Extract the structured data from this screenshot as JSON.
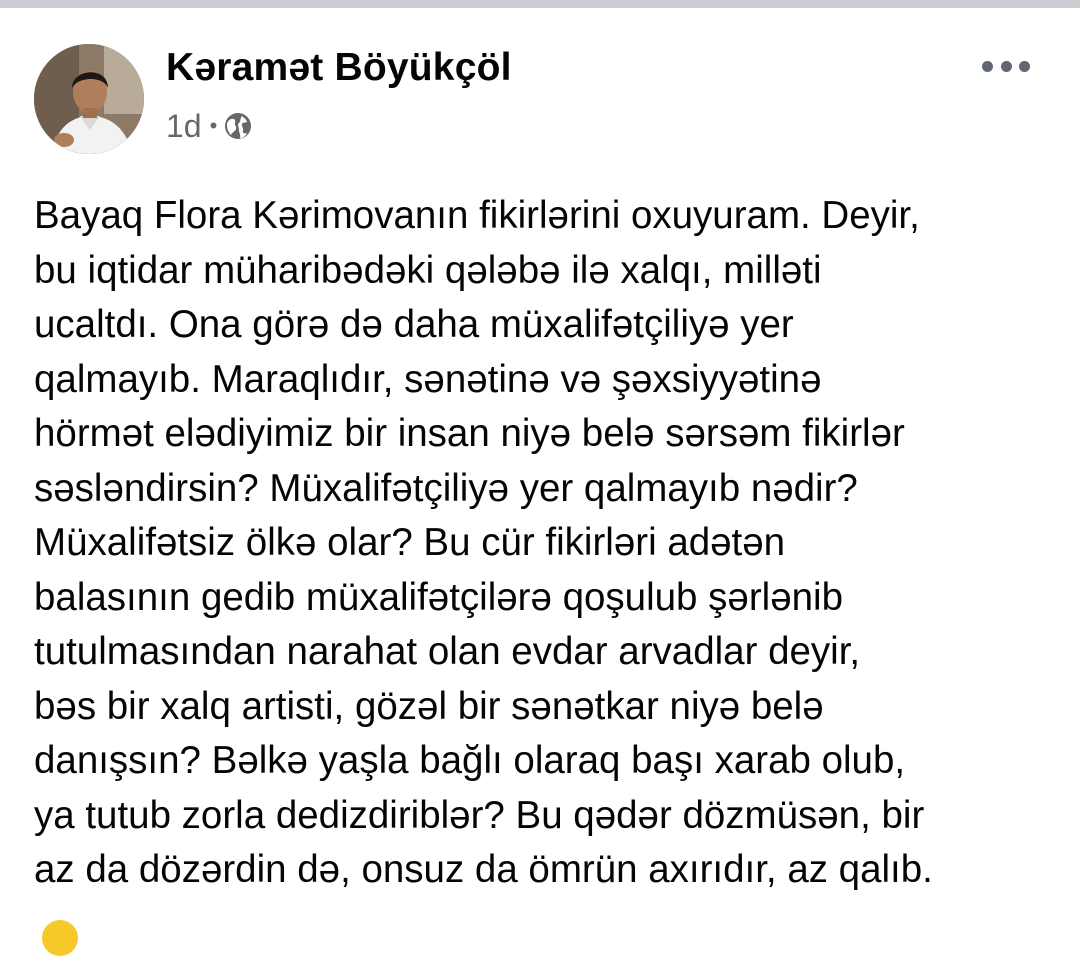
{
  "post": {
    "author_name": "Kəramət Böyükçöl",
    "timestamp": "1d",
    "separator": "•",
    "privacy_icon": "globe-icon",
    "more_icon": "more-horizontal-icon",
    "text": "Bayaq Flora Kərimovanın fikirlərini oxuyuram. Deyir,\nbu iqtidar müharibədəki qələbə ilə xalqı, milləti\nucaltdı. Ona görə də daha müxalifətçiliyə yer\nqalmayıb. Maraqlıdır, sənətinə və şəxsiyyətinə\nhörmət elədiyimiz bir insan niyə belə sərsəm fikirlər\nsəsləndirsin? Müxalifətçiliyə yer qalmayıb nədir?\nMüxalifətsiz ölkə olar? Bu cür fikirləri adətən\nbalasının gedib müxalifətçilərə qoşulub şərlənib\ntutulmasından narahat olan evdar arvadlar deyir,\nbəs bir xalq artisti, gözəl bir sənətkar niyə belə\ndanışsın? Bəlkə yaşla bağlı olaraq başı xarab olub,\nya tutub zorla dedizdiriblər? Bu qədər dözmüsən, bir\naz da dözərdin də, onsuz da ömrün axırıdır, az qalıb."
  },
  "colors": {
    "text_primary": "#050505",
    "text_secondary": "#65676b",
    "icon_gray": "#606770",
    "top_bar": "#c9ccd1",
    "emoji_yellow": "#f7c928"
  }
}
